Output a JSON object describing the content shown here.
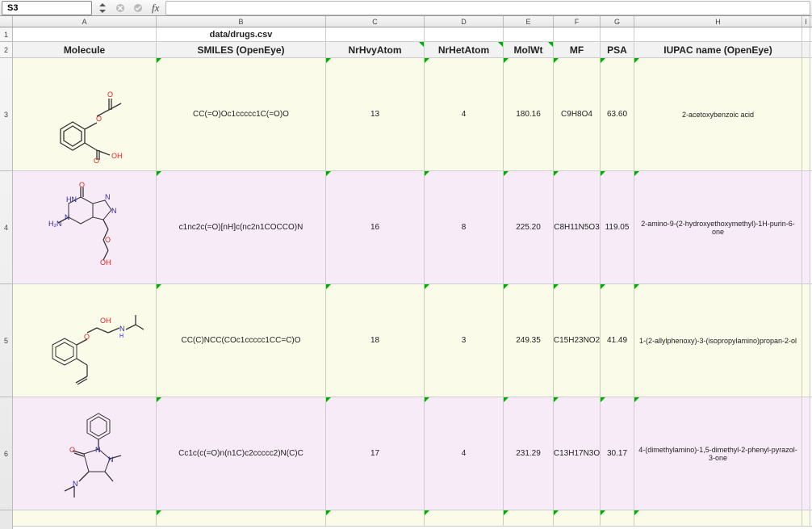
{
  "formula_bar": {
    "name_box": "S3",
    "fx_label": "fx",
    "formula_value": ""
  },
  "columns": [
    "A",
    "B",
    "C",
    "D",
    "E",
    "F",
    "G",
    "H",
    "I"
  ],
  "title": "data/drugs.csv",
  "headers": {
    "A": "Molecule",
    "B": "SMILES (OpenEye)",
    "C": "NrHvyAtom",
    "D": "NrHetAtom",
    "E": "MolWt",
    "F": "MF",
    "G": "PSA",
    "H": "IUPAC name (OpenEye)"
  },
  "rows": [
    {
      "smiles": "CC(=O)Oc1ccccc1C(=O)O",
      "nrhvy": "13",
      "nrhet": "4",
      "molwt": "180.16",
      "mf": "C9H8O4",
      "psa": "63.60",
      "iupac": "2-acetoxybenzoic acid"
    },
    {
      "smiles": "c1nc2c(=O)[nH]c(nc2n1COCCO)N",
      "nrhvy": "16",
      "nrhet": "8",
      "molwt": "225.20",
      "mf": "C8H11N5O3",
      "psa": "119.05",
      "iupac": "2-amino-9-(2-hydroxyethoxymethyl)-1H-purin-6-one"
    },
    {
      "smiles": "CC(C)NCC(COc1ccccc1CC=C)O",
      "nrhvy": "18",
      "nrhet": "3",
      "molwt": "249.35",
      "mf": "C15H23NO2",
      "psa": "41.49",
      "iupac": "1-(2-allylphenoxy)-3-(isopropylamino)propan-2-ol"
    },
    {
      "smiles": "Cc1c(c(=O)n(n1C)c2ccccc2)N(C)C",
      "nrhvy": "17",
      "nrhet": "4",
      "molwt": "231.29",
      "mf": "C13H17N3O",
      "psa": "30.17",
      "iupac": "4-(dimethylamino)-1,5-dimethyl-2-phenyl-pyrazol-3-one"
    }
  ],
  "row_heights": {
    "1": 18,
    "2": 20,
    "3": 140,
    "4": 140,
    "5": 140,
    "6": 140
  }
}
